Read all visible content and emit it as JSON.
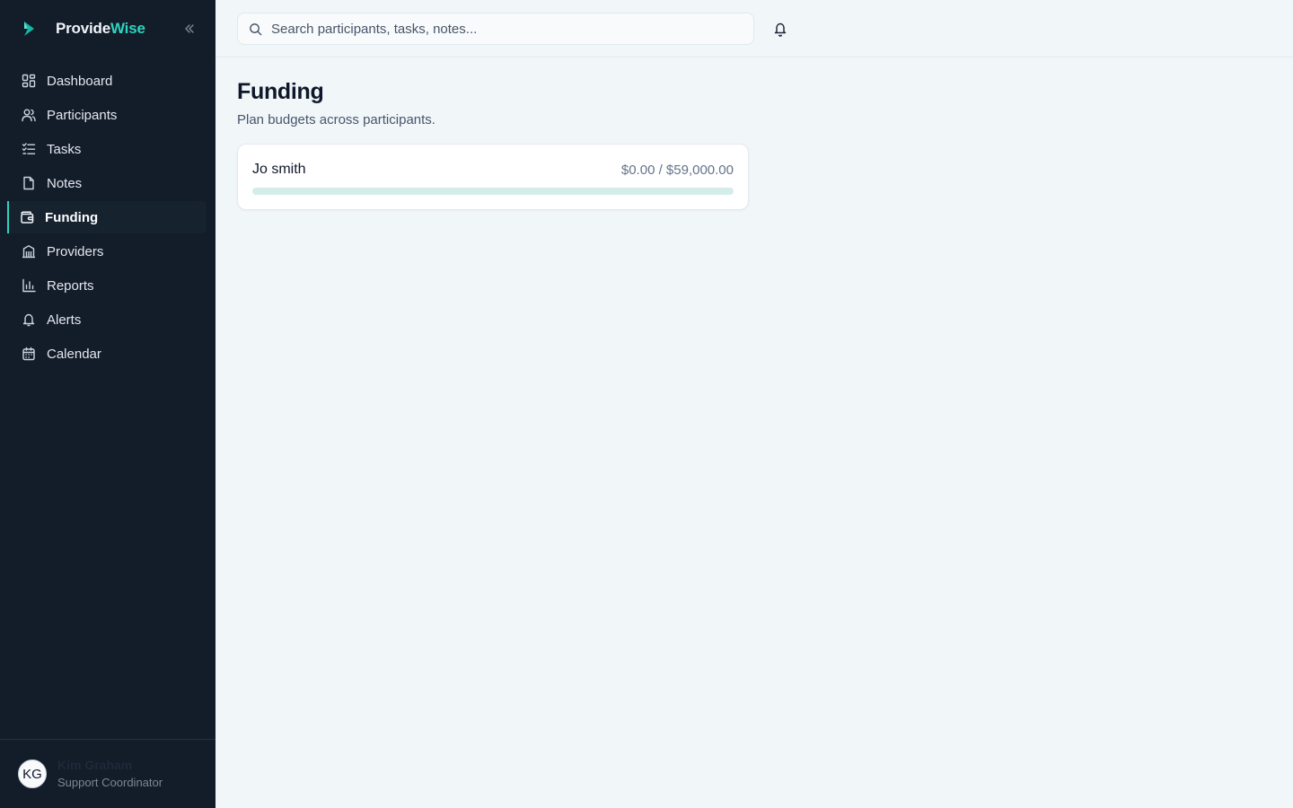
{
  "brand": {
    "name_part1": "Provide",
    "name_part2": "Wise",
    "accent": "#2dd4bf"
  },
  "sidebar": {
    "items": [
      {
        "label": "Dashboard",
        "icon": "dashboard-icon",
        "active": false
      },
      {
        "label": "Participants",
        "icon": "users-icon",
        "active": false
      },
      {
        "label": "Tasks",
        "icon": "list-check-icon",
        "active": false
      },
      {
        "label": "Notes",
        "icon": "file-icon",
        "active": false
      },
      {
        "label": "Funding",
        "icon": "wallet-icon",
        "active": true
      },
      {
        "label": "Providers",
        "icon": "building-icon",
        "active": false
      },
      {
        "label": "Reports",
        "icon": "bar-chart-icon",
        "active": false
      },
      {
        "label": "Alerts",
        "icon": "bell-icon",
        "active": false
      },
      {
        "label": "Calendar",
        "icon": "calendar-icon",
        "active": false
      }
    ]
  },
  "user": {
    "initials": "KG",
    "name": "Kim Graham",
    "role": "Support Coordinator"
  },
  "search": {
    "placeholder": "Search participants, tasks, notes..."
  },
  "page": {
    "title": "Funding",
    "subtitle": "Plan budgets across participants."
  },
  "budgets": [
    {
      "participant": "Jo smith",
      "amount_text": "$0.00 / $59,000.00",
      "spent": 0,
      "total": 59000,
      "progress_fraction": 0
    }
  ],
  "colors": {
    "sidebar_bg": "#131c29",
    "page_bg": "#f1f6f9",
    "accent": "#14b8a6"
  }
}
